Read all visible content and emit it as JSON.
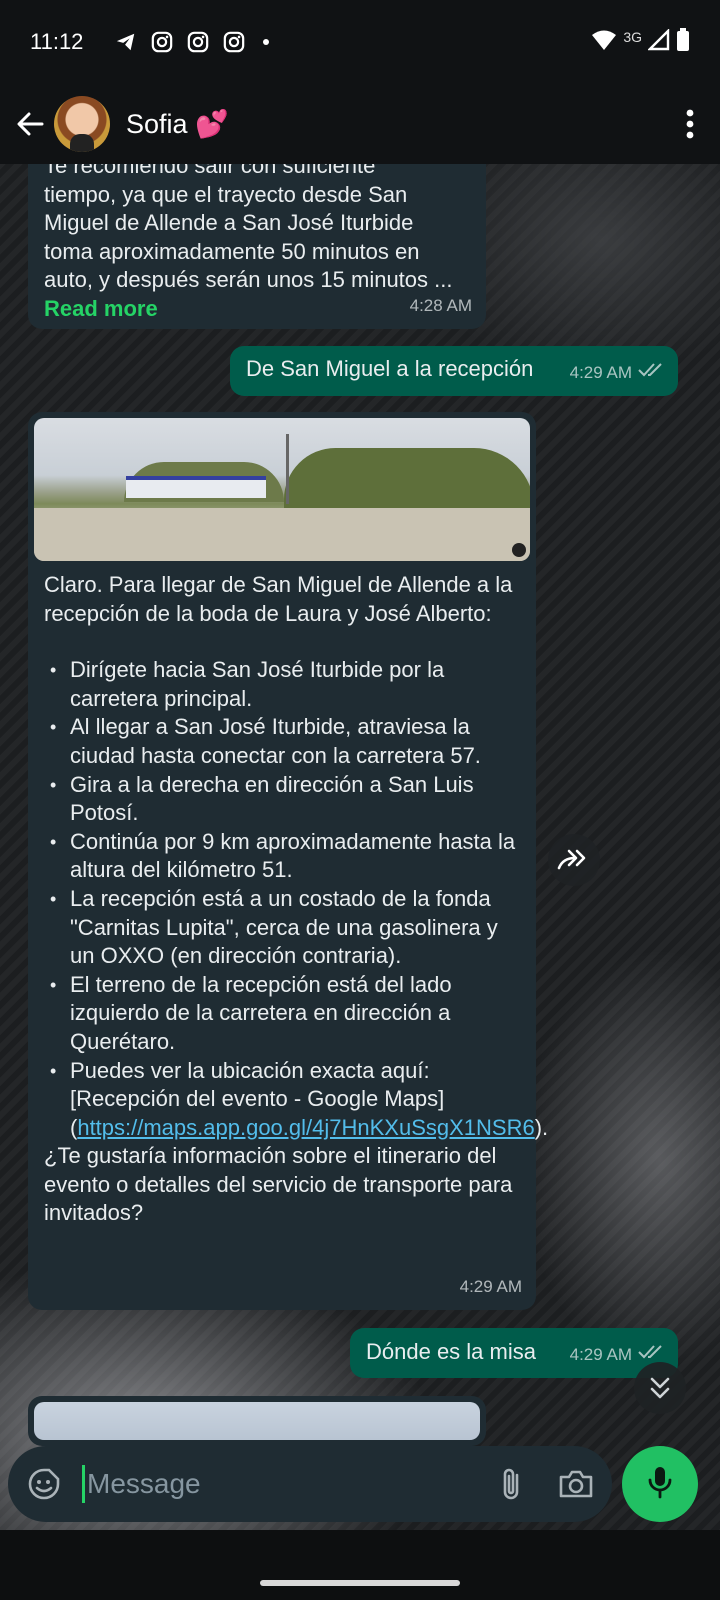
{
  "status_bar": {
    "time": "11:12",
    "network": "3G",
    "icons": [
      "telegram-icon",
      "instagram-icon",
      "instagram-icon",
      "instagram-icon",
      "notification-dot",
      "wifi-icon",
      "signal-icon",
      "battery-icon"
    ]
  },
  "header": {
    "contact_name": "Sofia 💕"
  },
  "messages": [
    {
      "direction": "incoming",
      "lines": [
        "Te recomiendo salir con suficiente",
        "tiempo, ya que el trayecto desde San",
        "Miguel de Allende a San José Iturbide",
        "toma aproximadamente 50 minutos en",
        "auto, y después serán unos 15 minutos ..."
      ],
      "read_more": "Read more",
      "time": "4:28 AM"
    },
    {
      "direction": "outgoing",
      "text": "De San Miguel a la recepción",
      "time": "4:29 AM"
    },
    {
      "direction": "incoming",
      "has_image": true,
      "intro": "Claro. Para llegar de San Miguel de Allende a la recepción de la boda de Laura y José Alberto:",
      "bullets": [
        "Dirígete hacia San José Iturbide por la carretera principal.",
        "Al llegar a San José Iturbide, atraviesa la ciudad hasta conectar con la carretera 57.",
        "Gira a la derecha en dirección a San Luis Potosí.",
        "Continúa por 9 km aproximadamente hasta la altura del kilómetro 51.",
        "La recepción está a un costado de la fonda \"Carnitas Lupita\", cerca de una gasolinera y un OXXO (en dirección contraria).",
        "El terreno de la recepción está del lado izquierdo de la carretera en dirección a Querétaro."
      ],
      "last_bullet_prefix": "Puedes ver la ubicación exacta aquí: [Recepción del evento - Google Maps](",
      "link": "https://maps.app.goo.gl/4j7HnKXuSsgX1NSR6",
      "last_bullet_suffix": ").",
      "question": "¿Te gustaría información sobre el itinerario del evento o detalles del servicio de transporte para invitados?",
      "time": "4:29 AM"
    },
    {
      "direction": "outgoing",
      "text": "Dónde es la misa",
      "time": "4:29 AM"
    }
  ],
  "composer": {
    "placeholder": "Message"
  },
  "colors": {
    "incoming_bubble": "#1f2c33",
    "outgoing_bubble": "#005c4b",
    "accent_green": "#25d366",
    "link": "#53bdeb"
  }
}
